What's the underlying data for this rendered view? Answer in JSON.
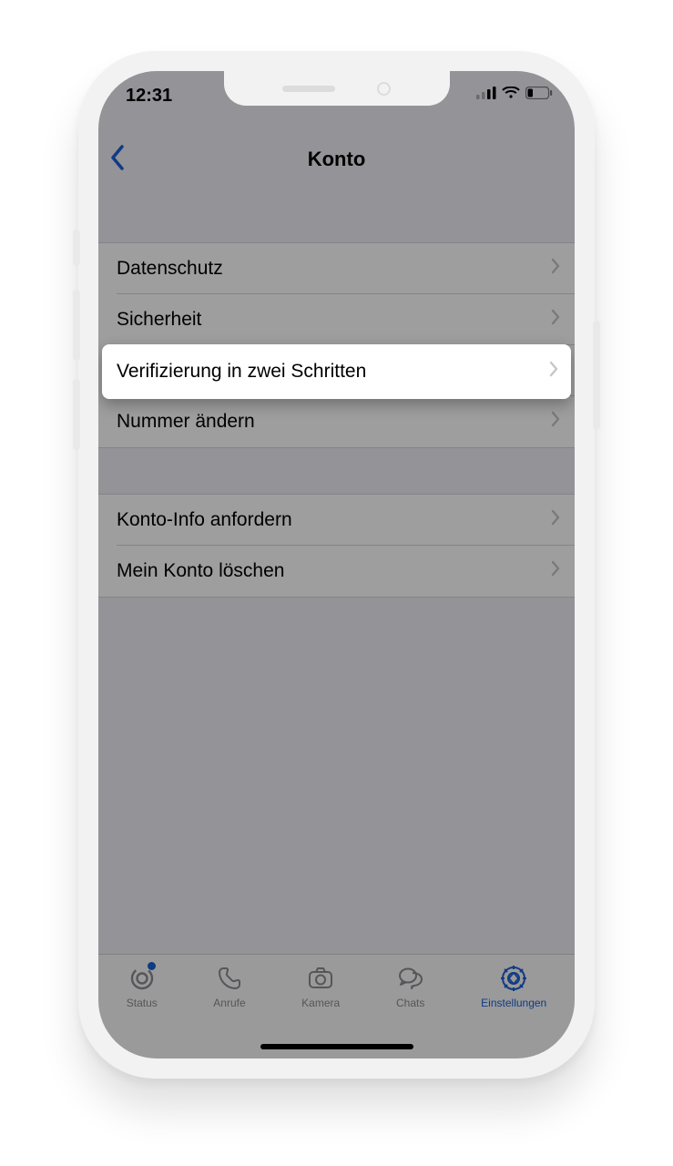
{
  "statusbar": {
    "time": "12:31"
  },
  "nav": {
    "title": "Konto"
  },
  "group1": {
    "items": [
      {
        "label": "Datenschutz"
      },
      {
        "label": "Sicherheit"
      },
      {
        "label": "Verifizierung in zwei Schritten"
      },
      {
        "label": "Nummer ändern"
      }
    ]
  },
  "group2": {
    "items": [
      {
        "label": "Konto-Info anfordern"
      },
      {
        "label": "Mein Konto löschen"
      }
    ]
  },
  "tabs": {
    "status": "Status",
    "calls": "Anrufe",
    "camera": "Kamera",
    "chats": "Chats",
    "settings": "Einstellungen"
  }
}
